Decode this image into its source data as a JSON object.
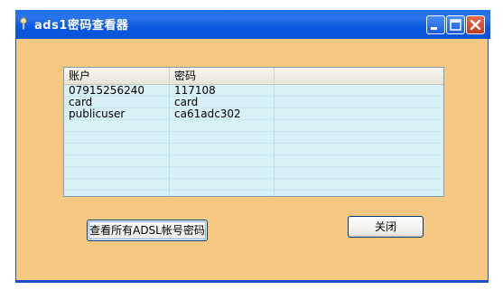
{
  "window": {
    "title": "ads1密码查看器",
    "title_icon": "key-icon"
  },
  "list": {
    "columns": [
      "账户",
      "密码",
      ""
    ],
    "rows": [
      {
        "account": "07915256240",
        "password": "117108"
      },
      {
        "account": "card",
        "password": "card"
      },
      {
        "account": "publicuser",
        "password": "ca61adc302"
      }
    ]
  },
  "buttons": {
    "view_all": "查看所有ADSL帐号密码",
    "close": "关闭"
  }
}
